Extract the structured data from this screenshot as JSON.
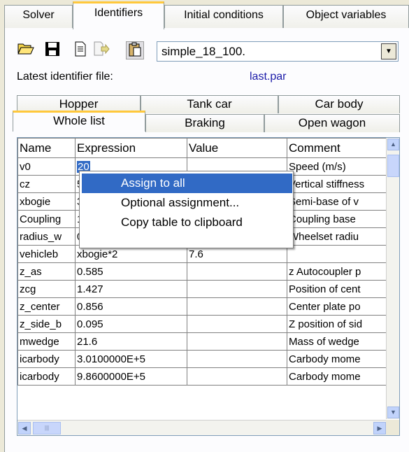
{
  "top_tabs": [
    "Solver",
    "Identifiers",
    "Initial conditions",
    "Object variables"
  ],
  "active_top_tab": 1,
  "toolbar": {
    "icons": [
      "open-folder-icon",
      "save-icon",
      "document-icon",
      "export-icon",
      "paste-icon"
    ],
    "file_value": "simple_18_100."
  },
  "latest": {
    "label": "Latest identifier file:",
    "value": "last.par"
  },
  "sub_tabs_back": [
    "Hopper",
    "Tank car",
    "Car body"
  ],
  "sub_tabs_front": [
    "Whole list",
    "Braking",
    "Open wagon"
  ],
  "active_sub_tab": "Whole list",
  "table": {
    "headers": [
      "Name",
      "Expression",
      "Value",
      "Comment"
    ],
    "rows": [
      [
        "v0",
        "20",
        "",
        "Speed (m/s)"
      ],
      [
        "cz",
        "5.7",
        "",
        "Vertical stiffness"
      ],
      [
        "xbogie",
        "3.8",
        "",
        "Semi-base of v"
      ],
      [
        "Coupling",
        "13",
        "",
        "Coupling base"
      ],
      [
        "radius_w",
        "0.475",
        "",
        "Wheelset radiu"
      ],
      [
        "vehicleb",
        "xbogie*2",
        "7.6",
        ""
      ],
      [
        "z_as",
        "0.585",
        "",
        "z Autocoupler p"
      ],
      [
        "zcg",
        "1.427",
        "",
        "Position of cent"
      ],
      [
        "z_center",
        "0.856",
        "",
        "Center plate po"
      ],
      [
        "z_side_b",
        "0.095",
        "",
        "Z position of sid"
      ],
      [
        "mwedge",
        "21.6",
        "",
        "Mass of wedge"
      ],
      [
        "icarbody",
        "3.0100000E+5",
        "",
        "Carbody mome"
      ],
      [
        "icarbody",
        "9.8600000E+5",
        "",
        "Carbody mome"
      ]
    ]
  },
  "context_menu": [
    "Assign to all",
    "Optional assignment...",
    "Copy table to clipboard"
  ],
  "colors": {
    "selection": "#316ac5",
    "tab_highlight": "#ffc83c",
    "link": "#1a1aa8"
  }
}
